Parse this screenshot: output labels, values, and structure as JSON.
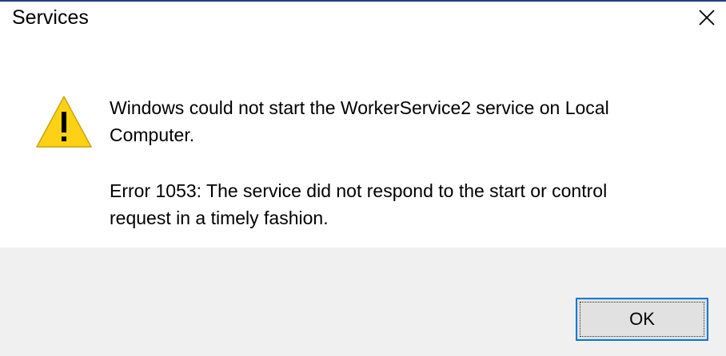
{
  "window": {
    "title": "Services",
    "close_icon": "close-icon"
  },
  "message": {
    "icon": "warning-icon",
    "primary": "Windows could not start the WorkerService2 service on Local Computer.",
    "secondary": "Error 1053: The service did not respond to the start or control request in a timely fashion."
  },
  "buttons": {
    "ok_label": "OK"
  },
  "colors": {
    "accent": "#0078d7",
    "footer": "#f0f0f0",
    "warning_fill": "#fcd116"
  }
}
